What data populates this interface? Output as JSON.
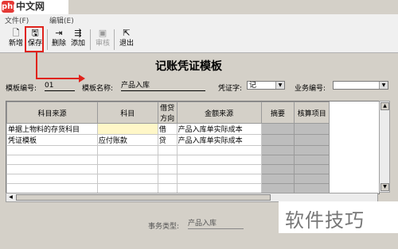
{
  "watermark_top": {
    "logo": "php",
    "text": "中文网"
  },
  "menu": {
    "items": [
      "文件(F)",
      "编辑(E)"
    ]
  },
  "toolbar": {
    "new": "新增",
    "save": "保存",
    "delete": "删除",
    "add": "添加",
    "review": "审核",
    "exit": "退出"
  },
  "header": {
    "title": "记账凭证模板"
  },
  "form": {
    "template_no_label": "模板编号:",
    "template_no": "01",
    "template_name_label": "模板名称:",
    "template_name": "产品入库",
    "voucher_label": "凭证字:",
    "voucher_value": "记",
    "business_no_label": "业务编号:",
    "business_no_value": ""
  },
  "grid": {
    "columns": [
      "科目来源",
      "科目",
      "借贷方向",
      "金额来源",
      "摘要",
      "核算项目"
    ],
    "rows": [
      [
        "单据上物料的存货科目",
        "",
        "借",
        "产品入库单实际成本",
        "",
        ""
      ],
      [
        "凭证模板",
        "应付账款",
        "贷",
        "产品入库单实际成本",
        "",
        ""
      ],
      [
        "",
        "",
        "",
        "",
        "",
        ""
      ],
      [
        "",
        "",
        "",
        "",
        "",
        ""
      ],
      [
        "",
        "",
        "",
        "",
        "",
        ""
      ],
      [
        "",
        "",
        "",
        "",
        "",
        ""
      ],
      [
        "",
        "",
        "",
        "",
        "",
        ""
      ],
      [
        "",
        "",
        "",
        "",
        "",
        ""
      ]
    ]
  },
  "footer": {
    "business_type_label": "事务类型:",
    "business_type": "产品入库"
  },
  "watermark_bottom": {
    "text": "软件技巧"
  },
  "colors": {
    "highlight": "#e0231c",
    "selected_cell": "#fff7c8"
  }
}
